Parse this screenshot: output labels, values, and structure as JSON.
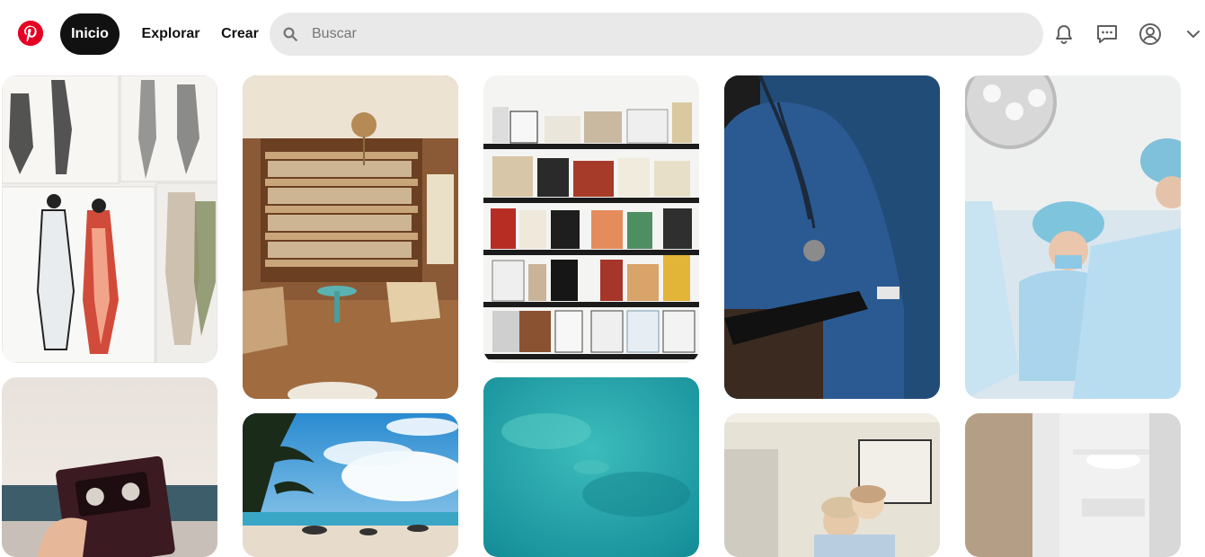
{
  "nav": {
    "home": "Inicio",
    "explore": "Explorar",
    "create": "Crear"
  },
  "search": {
    "placeholder": "Buscar",
    "value": ""
  },
  "icons": {
    "logo": "pinterest-logo-icon",
    "search": "search-icon",
    "notifications": "bell-icon",
    "messages": "chat-icon",
    "profile": "user-icon",
    "more": "chevron-down-icon"
  },
  "colors": {
    "brand": "#e60023",
    "active_nav": "#111111",
    "search_bg": "#e9e9e9"
  },
  "pins": [
    {
      "subject": "fashion-sketches"
    },
    {
      "subject": "vintage-library-room"
    },
    {
      "subject": "bookshelves"
    },
    {
      "subject": "doctor-scrubs"
    },
    {
      "subject": "surgery-team"
    },
    {
      "subject": "vhs-tape-beach"
    },
    {
      "subject": "tropical-beach"
    },
    {
      "subject": "ocean-aerial"
    },
    {
      "subject": "operating-room"
    },
    {
      "subject": "hospital-corridor"
    }
  ]
}
